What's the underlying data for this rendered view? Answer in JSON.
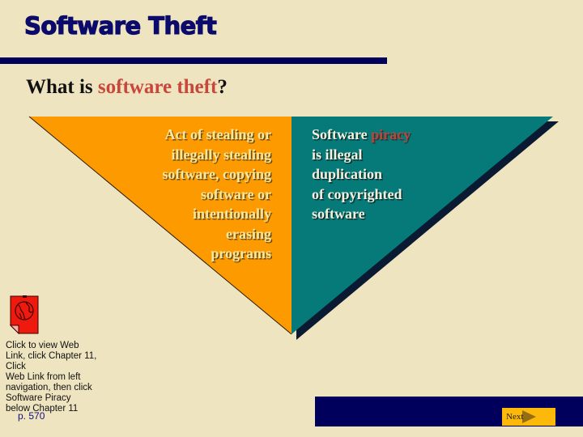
{
  "slide": {
    "title": "Software Theft",
    "subtitle": {
      "prefix": "What is ",
      "highlight": "software theft",
      "suffix": "?"
    }
  },
  "diagram": {
    "left_panel": {
      "color": "#fc9a00",
      "lines": [
        "Act of stealing or",
        "illegally stealing",
        "software, copying",
        "software or",
        "intentionally",
        "erasing",
        "programs"
      ]
    },
    "right_panel": {
      "color": "#057a78",
      "first_line_prefix": "Software ",
      "first_line_highlight": "piracy",
      "lines": [
        "is illegal",
        "duplication",
        "of copyrighted",
        "software"
      ]
    }
  },
  "web_link": {
    "icon": "web-link-globe-icon",
    "lines": [
      "Click to view Web",
      "Link, click Chapter 11,",
      "Click",
      "Web Link from left",
      "navigation, then click",
      "Software Piracy",
      "below Chapter 11"
    ],
    "page_ref": "p. 570"
  },
  "navigation": {
    "next_label": "Next",
    "next_icon": "play-arrow-icon"
  },
  "colors": {
    "background": "#efe4c0",
    "title": "#0b0b6b",
    "accent_red": "#c8463c",
    "nav_bar": "#00005c",
    "next_button": "#fdb90a"
  }
}
